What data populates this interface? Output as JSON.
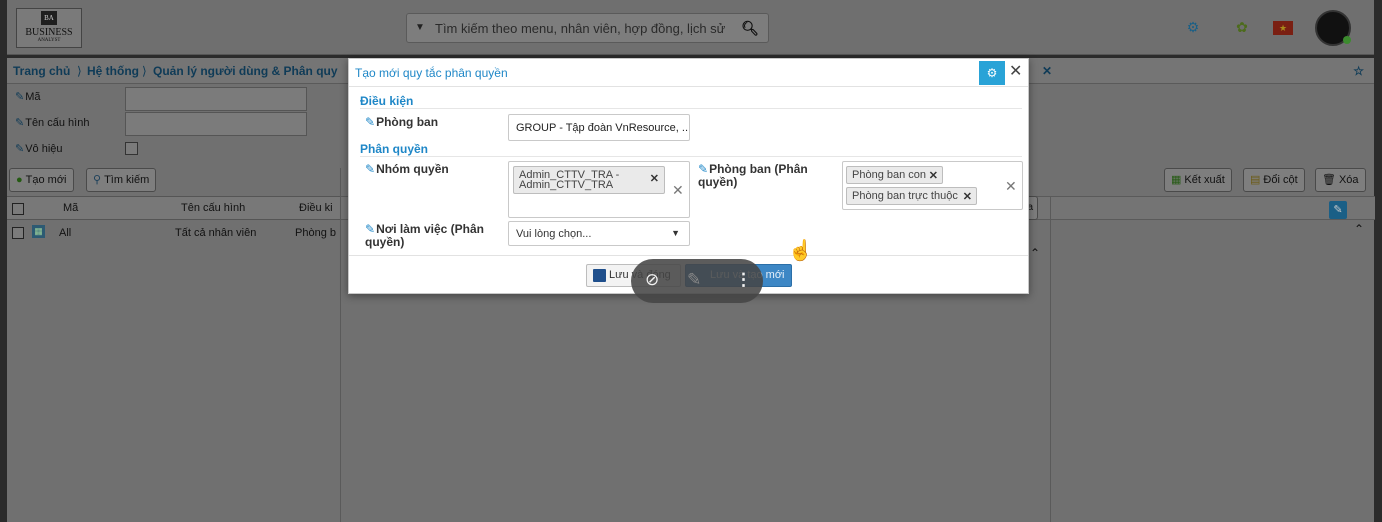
{
  "topbar": {
    "logo": {
      "mark": "BA",
      "name": "BUSINESS",
      "sub": "ANALYST"
    },
    "search_placeholder": "Tìm kiếm theo menu, nhân viên, hợp đồng, lịch sử",
    "icons": [
      "settings-icon",
      "plant-icon",
      "vietnam-flag-icon",
      "user-avatar"
    ]
  },
  "breadcrumb": {
    "home": "Trang chủ",
    "system": "Hệ thống",
    "page": "Quản lý người dùng & Phân quy"
  },
  "filters": {
    "code_label": "Mã",
    "config_name_label": "Tên cấu hình",
    "disabled_label": "Vô hiệu"
  },
  "toolbar": {
    "new_label": "Tạo mới",
    "search_label": "Tìm kiếm",
    "export_label": "Kết xuất",
    "change_columns_label": "Đổi cột",
    "delete_label": "Xóa"
  },
  "grid": {
    "columns": [
      "Mã",
      "Tên cấu hình",
      "Điều ki"
    ],
    "rows": [
      {
        "code": "All",
        "name": "Tất cả nhân viên",
        "cond": "Phòng b"
      }
    ],
    "partial_button": "óa"
  },
  "modal": {
    "title": "Tạo mới quy tắc phân quyền",
    "section_condition": "Điều kiện",
    "department_label": "Phòng ban",
    "department_value": "GROUP - Tập đoàn VnResource, ...",
    "section_permission": "Phân quyền",
    "group_label": "Nhóm quyền",
    "group_tags": [
      "Admin_CTTV_TRA - Admin_CTTV_TRA"
    ],
    "perm_department_label": "Phòng ban (Phân quyền)",
    "perm_department_tags": [
      "Phòng ban con",
      "Phòng ban trực thuộc"
    ],
    "workplace_label": "Nơi làm việc (Phân quyền)",
    "workplace_placeholder": "Vui lòng chọn...",
    "save_close_label": "Lưu và đóng",
    "save_new_label": "Lưu và tạo mới"
  },
  "colors": {
    "accent": "#1f87c7",
    "primary_button": "#3d87c5"
  }
}
